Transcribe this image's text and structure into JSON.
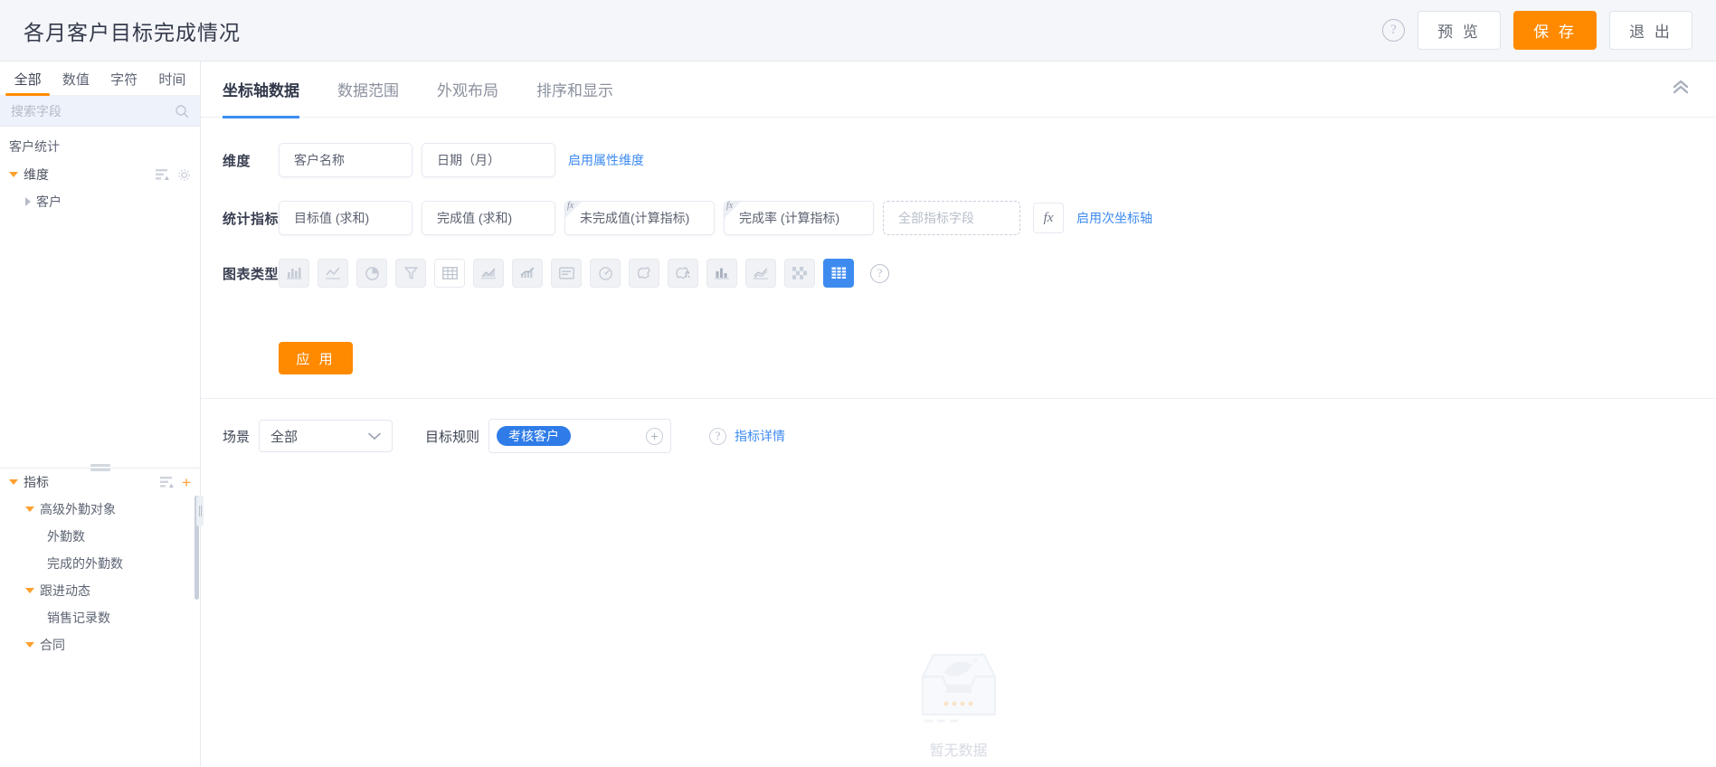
{
  "header": {
    "title": "各月客户目标完成情况",
    "help_icon": "question-circle-icon",
    "preview_label": "预 览",
    "save_label": "保 存",
    "exit_label": "退 出",
    "accent_orange": "#ff8a00"
  },
  "sidebar": {
    "type_tabs": [
      {
        "label": "全部",
        "active": true
      },
      {
        "label": "数值",
        "active": false
      },
      {
        "label": "字符",
        "active": false
      },
      {
        "label": "时间",
        "active": false
      }
    ],
    "search_placeholder": "搜索字段",
    "search_value": "",
    "search_icon": "search-icon",
    "source_name": "客户统计",
    "dimension_group": {
      "label": "维度",
      "items": [
        {
          "label": "客户",
          "level": 2,
          "expandable": true
        }
      ]
    },
    "metric_group": {
      "label": "指标",
      "items": [
        {
          "label": "高级外勤对象",
          "level": 2,
          "expandable": true
        },
        {
          "label": "外勤数",
          "level": 3,
          "expandable": false
        },
        {
          "label": "完成的外勤数",
          "level": 3,
          "expandable": false
        },
        {
          "label": "跟进动态",
          "level": 2,
          "expandable": true
        },
        {
          "label": "销售记录数",
          "level": 3,
          "expandable": false
        },
        {
          "label": "合同",
          "level": 2,
          "expandable": true
        }
      ]
    }
  },
  "main": {
    "tabs": [
      {
        "label": "坐标轴数据",
        "active": true
      },
      {
        "label": "数据范围",
        "active": false
      },
      {
        "label": "外观布局",
        "active": false
      },
      {
        "label": "排序和显示",
        "active": false
      }
    ],
    "collapse_icon": "double-chevron-up-icon",
    "dimension_row": {
      "label": "维度",
      "fields": [
        "客户名称",
        "日期（月）"
      ],
      "link": "启用属性维度"
    },
    "metric_row": {
      "label": "统计指标",
      "fields": [
        {
          "text": "目标值 (求和)",
          "computed": false
        },
        {
          "text": "完成值 (求和)",
          "computed": false
        },
        {
          "text": "未完成值(计算指标)",
          "computed": true
        },
        {
          "text": "完成率 (计算指标)",
          "computed": true
        }
      ],
      "placeholder_field": "全部指标字段",
      "fx_button": "fx",
      "link": "启用次坐标轴"
    },
    "chart_row": {
      "label": "图表类型",
      "help_icon": "question-circle-icon",
      "types": [
        {
          "name": "bar-chart-icon",
          "state": "normal"
        },
        {
          "name": "line-chart-icon",
          "state": "normal"
        },
        {
          "name": "pie-chart-icon",
          "state": "normal"
        },
        {
          "name": "funnel-chart-icon",
          "state": "normal"
        },
        {
          "name": "table-chart-icon",
          "state": "white"
        },
        {
          "name": "area-chart-icon",
          "state": "normal"
        },
        {
          "name": "combo-chart-icon",
          "state": "normal"
        },
        {
          "name": "card-text-icon",
          "state": "normal"
        },
        {
          "name": "gauge-chart-icon",
          "state": "normal"
        },
        {
          "name": "map-chart-icon",
          "state": "normal"
        },
        {
          "name": "map-scatter-icon",
          "state": "normal"
        },
        {
          "name": "column-chart-icon",
          "state": "normal"
        },
        {
          "name": "trend-line-icon",
          "state": "normal"
        },
        {
          "name": "heatmap-chart-icon",
          "state": "normal"
        },
        {
          "name": "pivot-table-icon",
          "state": "selected"
        }
      ]
    },
    "apply_label": "应 用",
    "scene_row": {
      "scene_label": "场景",
      "scene_value": "全部",
      "rule_label": "目标规则",
      "rule_tag": "考核客户",
      "add_icon": "plus-circle-icon",
      "help_icon": "question-circle-icon",
      "detail_link": "指标详情"
    },
    "empty_state": {
      "text": "暂无数据",
      "illustration": "empty-box-icon"
    }
  }
}
